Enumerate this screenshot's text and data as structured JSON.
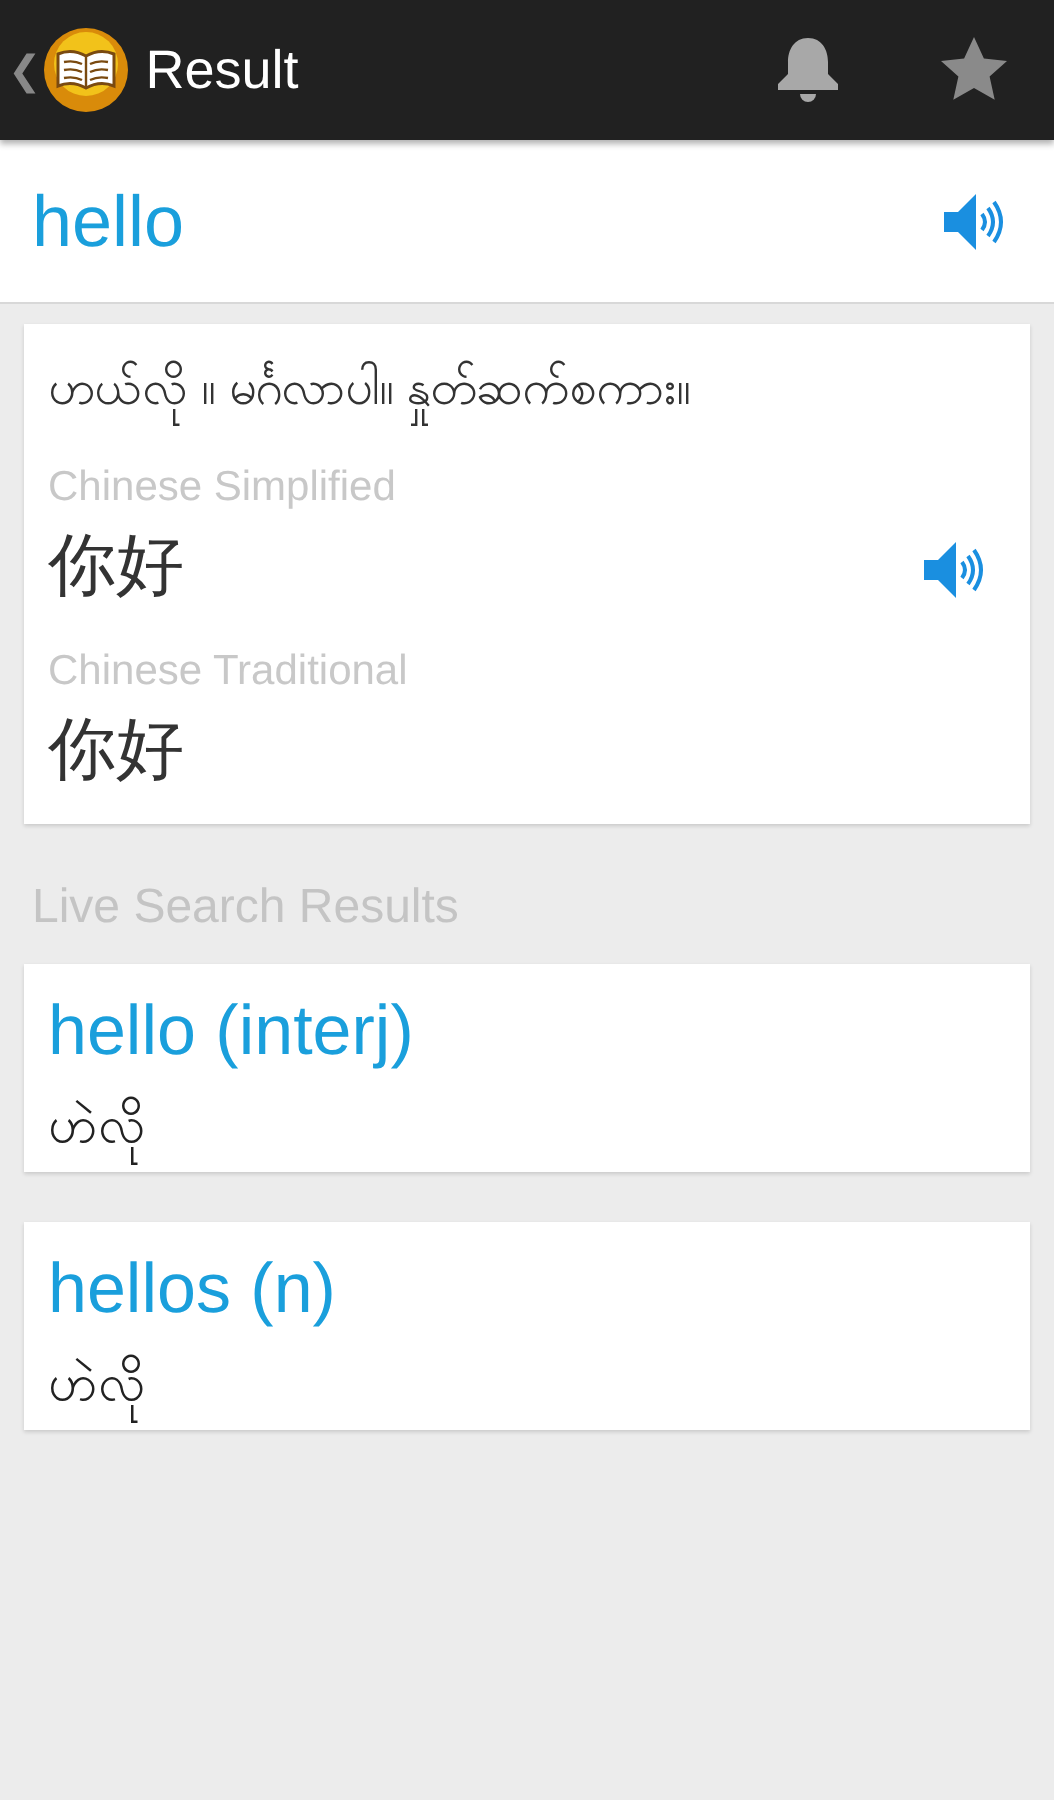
{
  "app_bar": {
    "back": "❮",
    "title": "Result"
  },
  "query": {
    "word": "hello",
    "audio": true
  },
  "translation_card": {
    "meaning": "ဟယ်လို ။ မင်္ဂလာပါ။ နှုတ်ဆက်စကား။",
    "translations": [
      {
        "language": "Chinese Simplified",
        "text": "你好",
        "audio": true
      },
      {
        "language": "Chinese Traditional",
        "text": "你好",
        "audio": false
      }
    ]
  },
  "live_search": {
    "heading": "Live Search Results",
    "results": [
      {
        "term": "hello (interj)",
        "meaning": "ဟဲလို"
      },
      {
        "term": "hellos (n)",
        "meaning": "ဟဲလို"
      }
    ]
  }
}
